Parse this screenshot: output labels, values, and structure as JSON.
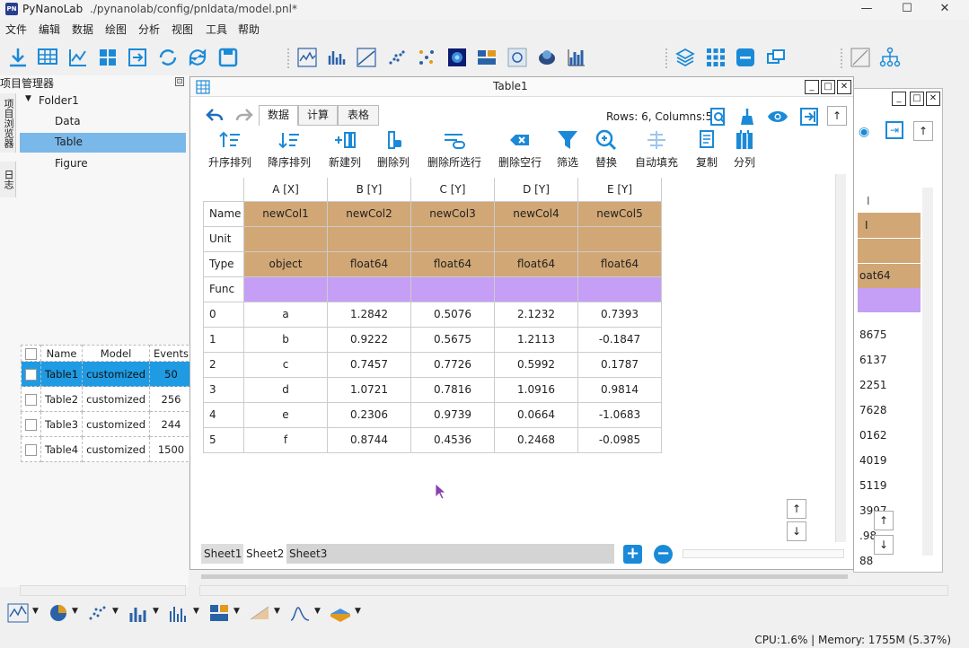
{
  "window": {
    "app_name": "PyNanoLab",
    "file_path": "./pynanolab/config/pnldata/model.pnl*",
    "logo_text": "PN"
  },
  "menu": [
    "文件",
    "编辑",
    "数据",
    "绘图",
    "分析",
    "视图",
    "工具",
    "帮助"
  ],
  "toolbar_icons": [
    "import-icon",
    "table-icon",
    "plot-icon",
    "split-icon",
    "export-icon",
    "refresh-cycle-icon",
    "refresh-icon",
    "save-icon",
    "line-chart-icon",
    "bar-chart-icon",
    "area-chart-icon",
    "scatter-icon",
    "dot-map-icon",
    "heatmap-icon",
    "image-icon",
    "image2-icon",
    "3d-icon",
    "histogram-icon",
    "layers-icon",
    "grid-icon",
    "minimize-icon",
    "restore-icon",
    "draw-icon",
    "tree-icon"
  ],
  "left_panel": {
    "title": "项目管理器",
    "vertical_tabs": [
      "项目浏览器",
      "日志"
    ],
    "tree": {
      "folder": "Folder1",
      "items": [
        "Data",
        "Table",
        "Figure"
      ],
      "selected": "Table"
    },
    "table": {
      "headers": [
        "Name",
        "Model",
        "Events"
      ],
      "rows": [
        {
          "name": "Table1",
          "model": "customized",
          "events": "50"
        },
        {
          "name": "Table2",
          "model": "customized",
          "events": "256"
        },
        {
          "name": "Table3",
          "model": "customized",
          "events": "244"
        },
        {
          "name": "Table4",
          "model": "customized",
          "events": "1500"
        }
      ]
    }
  },
  "table_window": {
    "title": "Table1",
    "tabs": [
      "数据",
      "计算",
      "表格"
    ],
    "active_tab": "数据",
    "rows_cols": "Rows: 6, Columns:5",
    "ribbon": [
      "升序排列",
      "降序排列",
      "新建列",
      "删除列",
      "删除所选行",
      "删除空行",
      "筛选",
      "替换",
      "自动填充",
      "复制",
      "分列"
    ],
    "column_headers": [
      "A [X]",
      "B [Y]",
      "C [Y]",
      "D [Y]",
      "E [Y]"
    ],
    "meta_labels": [
      "Name",
      "Unit",
      "Type",
      "Func"
    ],
    "names": [
      "newCol1",
      "newCol2",
      "newCol3",
      "newCol4",
      "newCol5"
    ],
    "units": [
      "",
      "",
      "",
      "",
      ""
    ],
    "types": [
      "object",
      "float64",
      "float64",
      "float64",
      "float64"
    ],
    "rows": [
      {
        "idx": "0",
        "cells": [
          "a",
          "1.2842",
          "0.5076",
          "2.1232",
          "0.7393"
        ]
      },
      {
        "idx": "1",
        "cells": [
          "b",
          "0.9222",
          "0.5675",
          "1.2113",
          "-0.1847"
        ]
      },
      {
        "idx": "2",
        "cells": [
          "c",
          "0.7457",
          "0.7726",
          "0.5992",
          "0.1787"
        ]
      },
      {
        "idx": "3",
        "cells": [
          "d",
          "1.0721",
          "0.7816",
          "1.0916",
          "0.9814"
        ]
      },
      {
        "idx": "4",
        "cells": [
          "e",
          "0.2306",
          "0.9739",
          "0.0664",
          "-1.0683"
        ]
      },
      {
        "idx": "5",
        "cells": [
          "f",
          "0.8744",
          "0.4536",
          "0.2468",
          "-0.0985"
        ]
      }
    ],
    "sheets": [
      "Sheet1",
      "Sheet2",
      "Sheet3"
    ]
  },
  "background_window": {
    "header": "I",
    "name_cell": "I",
    "type_cell": "oat64",
    "values": [
      "8675",
      "6137",
      "2251",
      "7628",
      "0162",
      "4019",
      "5119",
      "3997",
      ".98",
      "88"
    ]
  },
  "status": "CPU:1.6% | Memory: 1755M (5.37%)",
  "colors": {
    "accent": "#1e9be3",
    "meta_row": "#d1a775",
    "func_row": "#c59ef5",
    "icon_blue": "#1a8ad8"
  }
}
